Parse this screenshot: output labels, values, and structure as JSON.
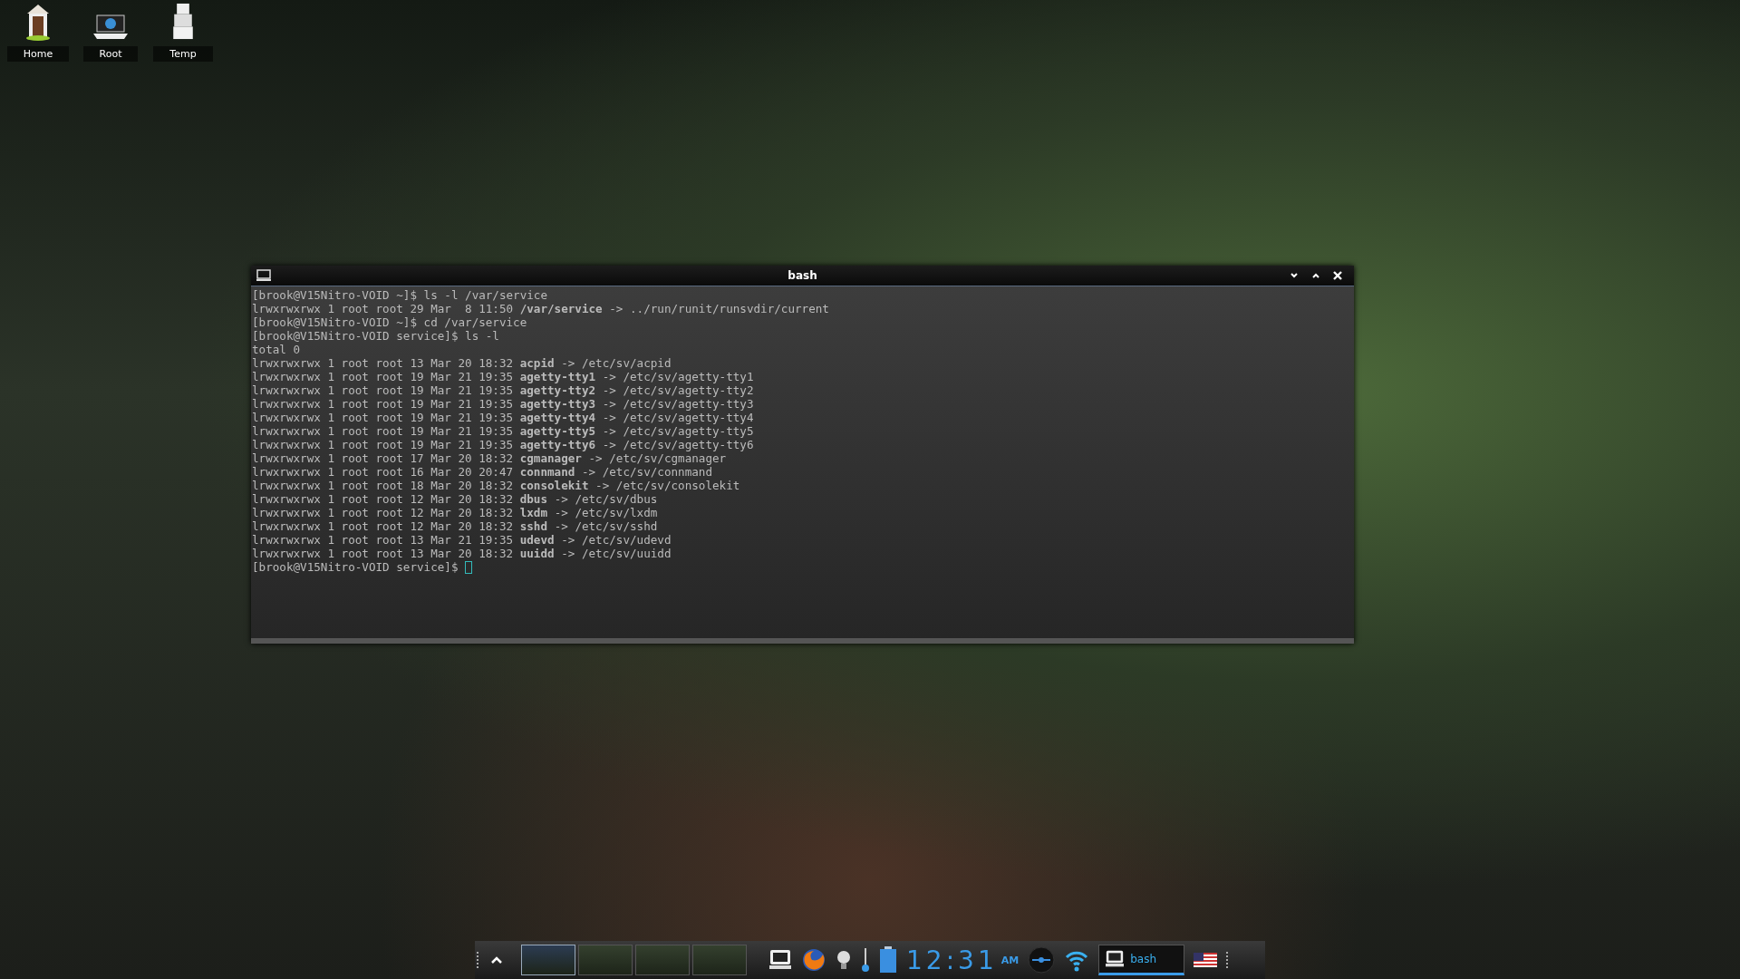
{
  "desktop_icons": [
    {
      "kind": "home",
      "label": "Home"
    },
    {
      "kind": "computer",
      "label": "Root"
    },
    {
      "kind": "files",
      "label": "Temp"
    }
  ],
  "window": {
    "title": "bash",
    "lines": [
      "[brook@V15Nitro-VOID ~]$ ls -l /var/service",
      "lrwxrwxrwx 1 root root 29 Mar  8 11:50 **/var/service** -> ../run/runit/runsvdir/current",
      "[brook@V15Nitro-VOID ~]$ cd /var/service",
      "[brook@V15Nitro-VOID service]$ ls -l",
      "total 0",
      "lrwxrwxrwx 1 root root 13 Mar 20 18:32 **acpid** -> /etc/sv/acpid",
      "lrwxrwxrwx 1 root root 19 Mar 21 19:35 **agetty-tty1** -> /etc/sv/agetty-tty1",
      "lrwxrwxrwx 1 root root 19 Mar 21 19:35 **agetty-tty2** -> /etc/sv/agetty-tty2",
      "lrwxrwxrwx 1 root root 19 Mar 21 19:35 **agetty-tty3** -> /etc/sv/agetty-tty3",
      "lrwxrwxrwx 1 root root 19 Mar 21 19:35 **agetty-tty4** -> /etc/sv/agetty-tty4",
      "lrwxrwxrwx 1 root root 19 Mar 21 19:35 **agetty-tty5** -> /etc/sv/agetty-tty5",
      "lrwxrwxrwx 1 root root 19 Mar 21 19:35 **agetty-tty6** -> /etc/sv/agetty-tty6",
      "lrwxrwxrwx 1 root root 17 Mar 20 18:32 **cgmanager** -> /etc/sv/cgmanager",
      "lrwxrwxrwx 1 root root 16 Mar 20 20:47 **connmand** -> /etc/sv/connmand",
      "lrwxrwxrwx 1 root root 18 Mar 20 18:32 **consolekit** -> /etc/sv/consolekit",
      "lrwxrwxrwx 1 root root 12 Mar 20 18:32 **dbus** -> /etc/sv/dbus",
      "lrwxrwxrwx 1 root root 12 Mar 20 18:32 **lxdm** -> /etc/sv/lxdm",
      "lrwxrwxrwx 1 root root 12 Mar 20 18:32 **sshd** -> /etc/sv/sshd",
      "lrwxrwxrwx 1 root root 13 Mar 21 19:35 **udevd** -> /etc/sv/udevd",
      "lrwxrwxrwx 1 root root 13 Mar 20 18:32 **uuidd** -> /etc/sv/uuidd"
    ],
    "prompt": "[brook@V15Nitro-VOID service]$"
  },
  "taskbar": {
    "workspaces": [
      {
        "selected": true
      },
      {
        "selected": false
      },
      {
        "selected": false
      },
      {
        "selected": false
      }
    ],
    "clock": {
      "time": "12:31",
      "period": "AM"
    },
    "tasks": [
      {
        "label": "bash",
        "selected": true
      }
    ]
  }
}
